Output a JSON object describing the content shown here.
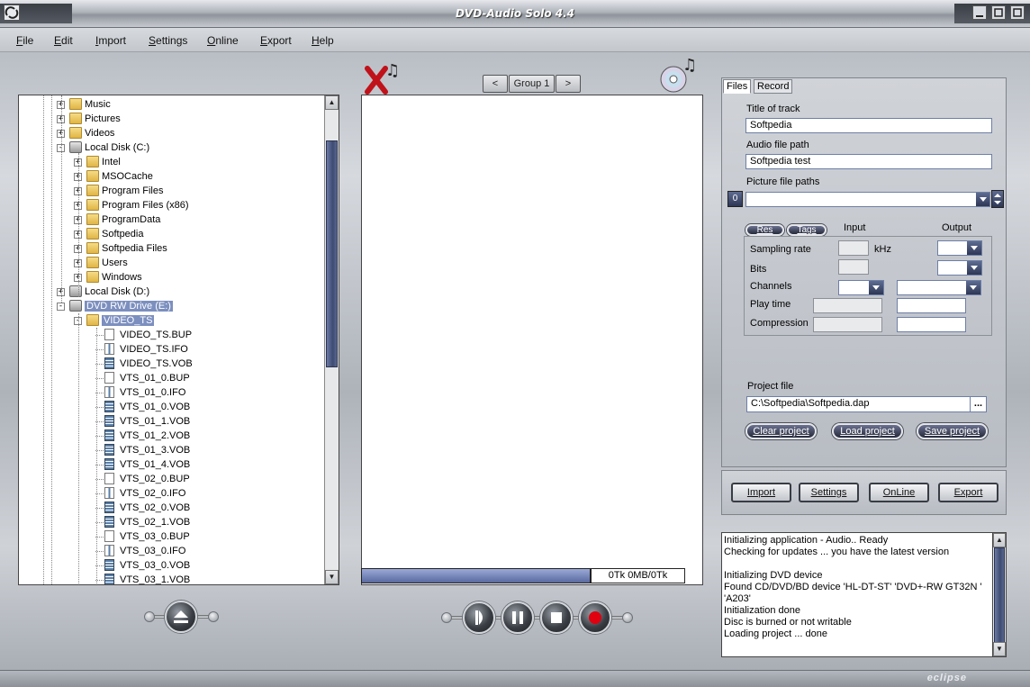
{
  "app": {
    "title": "DVD-Audio Solo 4.4",
    "brand": "eclipse"
  },
  "menu": [
    "File",
    "Edit",
    "Import",
    "Settings",
    "Online",
    "Export",
    "Help"
  ],
  "tree": [
    {
      "label": "Music",
      "level": 0,
      "icon": "folder-music-icon",
      "expand": "+"
    },
    {
      "label": "Pictures",
      "level": 0,
      "icon": "folder-pictures-icon",
      "expand": "+"
    },
    {
      "label": "Videos",
      "level": 0,
      "icon": "folder-videos-icon",
      "expand": "+"
    },
    {
      "label": "Local Disk (C:)",
      "level": 0,
      "icon": "drive-icon",
      "expand": "-"
    },
    {
      "label": "Intel",
      "level": 1,
      "icon": "folder-icon",
      "expand": "+"
    },
    {
      "label": "MSOCache",
      "level": 1,
      "icon": "folder-icon",
      "expand": "+"
    },
    {
      "label": "Program Files",
      "level": 1,
      "icon": "folder-icon",
      "expand": "+"
    },
    {
      "label": "Program Files (x86)",
      "level": 1,
      "icon": "folder-icon",
      "expand": "+"
    },
    {
      "label": "ProgramData",
      "level": 1,
      "icon": "folder-icon",
      "expand": "+"
    },
    {
      "label": "Softpedia",
      "level": 1,
      "icon": "folder-icon",
      "expand": "+"
    },
    {
      "label": "Softpedia Files",
      "level": 1,
      "icon": "folder-icon",
      "expand": "+"
    },
    {
      "label": "Users",
      "level": 1,
      "icon": "folder-icon",
      "expand": "+"
    },
    {
      "label": "Windows",
      "level": 1,
      "icon": "folder-icon",
      "expand": "+"
    },
    {
      "label": "Local Disk (D:)",
      "level": 0,
      "icon": "drive-icon",
      "expand": "+"
    },
    {
      "label": "DVD RW Drive (E:)",
      "level": 0,
      "icon": "dvd-drive-icon",
      "expand": "-",
      "selected": true
    },
    {
      "label": "VIDEO_TS",
      "level": 1,
      "icon": "folder-open-icon",
      "expand": "-",
      "selected": true
    },
    {
      "label": "VIDEO_TS.BUP",
      "level": 2,
      "icon": "file-icon"
    },
    {
      "label": "VIDEO_TS.IFO",
      "level": 2,
      "icon": "ifo-file-icon"
    },
    {
      "label": "VIDEO_TS.VOB",
      "level": 2,
      "icon": "vob-file-icon"
    },
    {
      "label": "VTS_01_0.BUP",
      "level": 2,
      "icon": "file-icon"
    },
    {
      "label": "VTS_01_0.IFO",
      "level": 2,
      "icon": "ifo-file-icon"
    },
    {
      "label": "VTS_01_0.VOB",
      "level": 2,
      "icon": "vob-file-icon"
    },
    {
      "label": "VTS_01_1.VOB",
      "level": 2,
      "icon": "vob-file-icon"
    },
    {
      "label": "VTS_01_2.VOB",
      "level": 2,
      "icon": "vob-file-icon"
    },
    {
      "label": "VTS_01_3.VOB",
      "level": 2,
      "icon": "vob-file-icon"
    },
    {
      "label": "VTS_01_4.VOB",
      "level": 2,
      "icon": "vob-file-icon"
    },
    {
      "label": "VTS_02_0.BUP",
      "level": 2,
      "icon": "file-icon"
    },
    {
      "label": "VTS_02_0.IFO",
      "level": 2,
      "icon": "ifo-file-icon"
    },
    {
      "label": "VTS_02_0.VOB",
      "level": 2,
      "icon": "vob-file-icon"
    },
    {
      "label": "VTS_02_1.VOB",
      "level": 2,
      "icon": "vob-file-icon"
    },
    {
      "label": "VTS_03_0.BUP",
      "level": 2,
      "icon": "file-icon"
    },
    {
      "label": "VTS_03_0.IFO",
      "level": 2,
      "icon": "ifo-file-icon"
    },
    {
      "label": "VTS_03_0.VOB",
      "level": 2,
      "icon": "vob-file-icon"
    },
    {
      "label": "VTS_03_1.VOB",
      "level": 2,
      "icon": "vob-file-icon"
    }
  ],
  "group": {
    "prev": "<",
    "label": "Group 1",
    "next": ">"
  },
  "progress": {
    "text": "0Tk 0MB/0Tk",
    "fraction": 1.0
  },
  "tabs": {
    "files": "Files",
    "record": "Record"
  },
  "files": {
    "title_label": "Title of track",
    "title_value": "Softpedia",
    "audio_label": "Audio file path",
    "audio_value": "Softpedia test",
    "picture_label": "Picture file paths",
    "picture_value": "",
    "picture_counter": "0"
  },
  "format": {
    "res_button": "Res",
    "tags_button": "Tags",
    "input_header": "Input",
    "output_header": "Output",
    "sampling_label": "Sampling rate",
    "sampling_unit": "kHz",
    "bits_label": "Bits",
    "channels_label": "Channels",
    "playtime_label": "Play time",
    "compression_label": "Compression"
  },
  "project": {
    "label": "Project file",
    "value": "C:\\Softpedia\\Softpedia.dap",
    "browse": "...",
    "clear": "Clear project",
    "load": "Load project",
    "save": "Save project"
  },
  "actions": {
    "import": "Import",
    "settings": "Settings",
    "online": "OnLine",
    "export": "Export"
  },
  "log": [
    "Initializing application - Audio.. Ready",
    "Checking for updates ... you have the latest version",
    "",
    "Initializing DVD device",
    "Found CD/DVD/BD device 'HL-DT-ST' 'DVD+-RW GT32N   '",
    "'A203'",
    "Initialization done",
    "Disc is burned or not writable",
    "Loading project ... done"
  ],
  "colors": {
    "accent": "#3d4a72",
    "selection": "#7c8fbf",
    "record": "#e00010"
  }
}
